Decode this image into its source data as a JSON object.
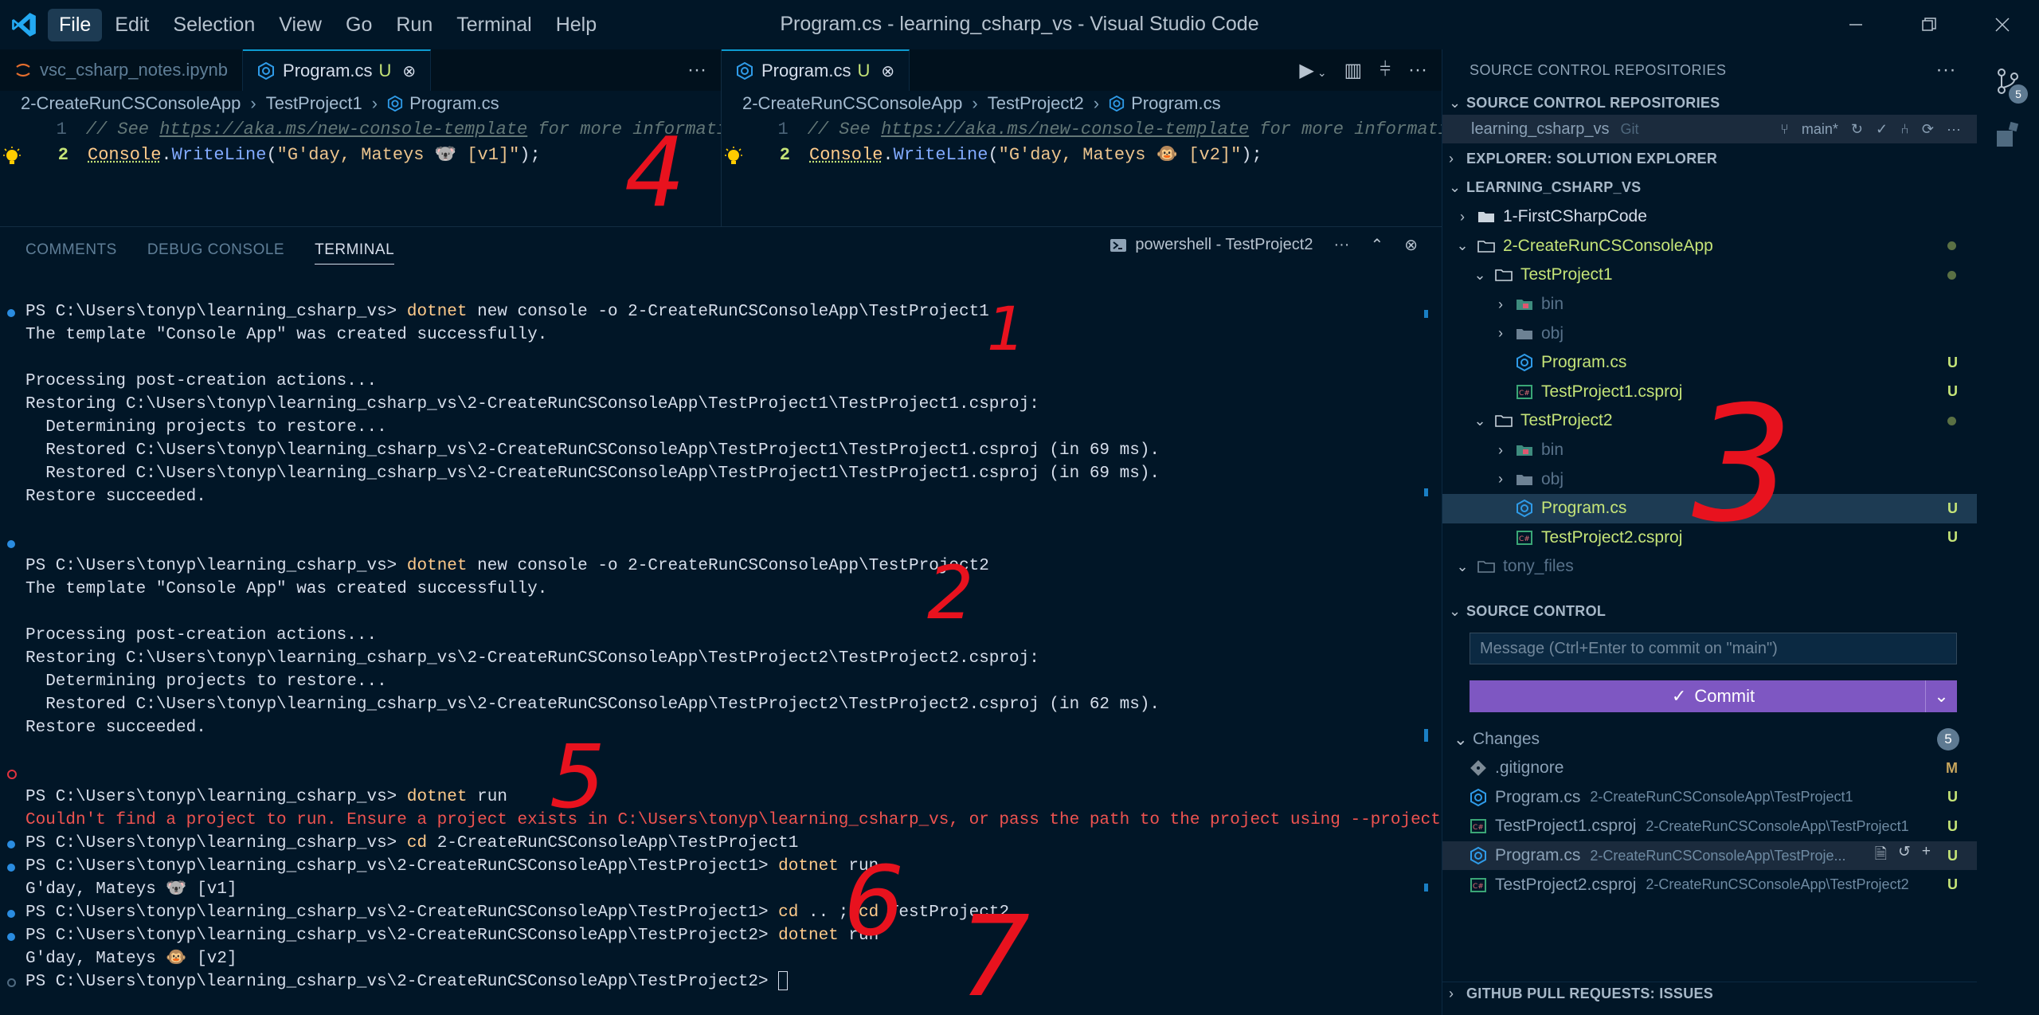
{
  "titlebar": {
    "menu": [
      "File",
      "Edit",
      "Selection",
      "View",
      "Go",
      "Run",
      "Terminal",
      "Help"
    ],
    "title": "Program.cs - learning_csharp_vs - Visual Studio Code"
  },
  "editor_left": {
    "tabs": [
      {
        "label": "vsc_csharp_notes.ipynb",
        "modified": ""
      },
      {
        "label": "Program.cs",
        "modified": "U"
      }
    ],
    "breadcrumb": [
      "2-CreateRunCSConsoleApp",
      "TestProject1",
      "Program.cs"
    ],
    "lines": [
      {
        "num": "1",
        "comment_prefix": "// See ",
        "url": "https://aka.ms/new-console-template",
        "comment_suffix": " for more informatio"
      },
      {
        "num": "2",
        "class": "Console",
        "dot": ".",
        "method": "WriteLine",
        "open": "(",
        "string": "\"G'day, Mateys 🐨 [v1]\"",
        "close": ");"
      }
    ]
  },
  "editor_right": {
    "tabs": [
      {
        "label": "Program.cs",
        "modified": "U"
      }
    ],
    "breadcrumb": [
      "2-CreateRunCSConsoleApp",
      "TestProject2",
      "Program.cs"
    ],
    "lines": [
      {
        "num": "1",
        "comment_prefix": "// See ",
        "url": "https://aka.ms/new-console-template",
        "comment_suffix": " for more informatio"
      },
      {
        "num": "2",
        "class": "Console",
        "dot": ".",
        "method": "WriteLine",
        "open": "(",
        "string": "\"G'day, Mateys 🐵 [v2]\"",
        "close": ");"
      }
    ]
  },
  "panel": {
    "tabs": [
      "COMMENTS",
      "DEBUG CONSOLE",
      "TERMINAL"
    ],
    "terminal_name": "powershell - TestProject2"
  },
  "terminal": {
    "prompt_root": "PS C:\\Users\\tonyp\\learning_csharp_vs> ",
    "prompt_tp1": "PS C:\\Users\\tonyp\\learning_csharp_vs\\2-CreateRunCSConsoleApp\\TestProject1> ",
    "prompt_tp2": "PS C:\\Users\\tonyp\\learning_csharp_vs\\2-CreateRunCSConsoleApp\\TestProject2> ",
    "dotnet": "dotnet",
    "cmd1_rest": " new console -o 2-CreateRunCSConsoleApp\\TestProject1",
    "cmd2_rest": " new console -o 2-CreateRunCSConsoleApp\\TestProject2",
    "cmd_run_rest": " run",
    "cmd_cd1": "cd",
    "cmd_cd1_rest": " 2-CreateRunCSConsoleApp\\TestProject1",
    "cmd_cd2_a": "cd",
    "cmd_cd2_b": " .. ; ",
    "cmd_cd2_c": "cd",
    "cmd_cd2_d": " TestProject2",
    "created": "The template \"Console App\" was created successfully.",
    "post": "Processing post-creation actions...",
    "restoring1": "Restoring C:\\Users\\tonyp\\learning_csharp_vs\\2-CreateRunCSConsoleApp\\TestProject1\\TestProject1.csproj:",
    "determining": "  Determining projects to restore...",
    "restored1": "  Restored C:\\Users\\tonyp\\learning_csharp_vs\\2-CreateRunCSConsoleApp\\TestProject1\\TestProject1.csproj (in 69 ms).",
    "succeeded": "Restore succeeded.",
    "restoring2": "Restoring C:\\Users\\tonyp\\learning_csharp_vs\\2-CreateRunCSConsoleApp\\TestProject2\\TestProject2.csproj:",
    "restored2": "  Restored C:\\Users\\tonyp\\learning_csharp_vs\\2-CreateRunCSConsoleApp\\TestProject2\\TestProject2.csproj (in 62 ms).",
    "error": "Couldn't find a project to run. Ensure a project exists in C:\\Users\\tonyp\\learning_csharp_vs, or pass the path to the project using --project.",
    "out_v1": "G'day, Mateys 🐨 [v1]",
    "out_v2": "G'day, Mateys 🐵 [v2]"
  },
  "sidebar": {
    "title": "SOURCE CONTROL REPOSITORIES",
    "sections": {
      "repos": "SOURCE CONTROL REPOSITORIES",
      "solution": "EXPLORER: SOLUTION EXPLORER",
      "folder": "LEARNING_CSHARP_VS",
      "source_control": "SOURCE CONTROL",
      "github": "GITHUB PULL REQUESTS: ISSUES"
    },
    "repo": {
      "name": "learning_csharp_vs",
      "provider": "Git",
      "branch": "main*"
    },
    "tree": [
      {
        "label": "1-FirstCSharpCode",
        "badge": ""
      },
      {
        "label": "2-CreateRunCSConsoleApp",
        "badge": ""
      },
      {
        "label": "TestProject1",
        "badge": ""
      },
      {
        "label": "bin",
        "badge": ""
      },
      {
        "label": "obj",
        "badge": ""
      },
      {
        "label": "Program.cs",
        "badge": "U"
      },
      {
        "label": "TestProject1.csproj",
        "badge": "U"
      },
      {
        "label": "TestProject2",
        "badge": ""
      },
      {
        "label": "bin",
        "badge": ""
      },
      {
        "label": "obj",
        "badge": ""
      },
      {
        "label": "Program.cs",
        "badge": "U"
      },
      {
        "label": "TestProject2.csproj",
        "badge": "U"
      },
      {
        "label": "tony_files",
        "badge": ""
      }
    ],
    "message_placeholder": "Message (Ctrl+Enter to commit on \"main\")",
    "commit_label": "Commit",
    "changes_label": "Changes",
    "changes_count": "5",
    "changes": [
      {
        "label": ".gitignore",
        "path": "",
        "badge": "M"
      },
      {
        "label": "Program.cs",
        "path": "2-CreateRunCSConsoleApp\\TestProject1",
        "badge": "U"
      },
      {
        "label": "TestProject1.csproj",
        "path": "2-CreateRunCSConsoleApp\\TestProject1",
        "badge": "U"
      },
      {
        "label": "Program.cs",
        "path": "2-CreateRunCSConsoleApp\\TestProje...",
        "badge": "U"
      },
      {
        "label": "TestProject2.csproj",
        "path": "2-CreateRunCSConsoleApp\\TestProject2",
        "badge": "U"
      }
    ]
  },
  "activity": {
    "scm_badge": "5"
  },
  "annotations": [
    "1",
    "2",
    "3",
    "4",
    "5",
    "6",
    "7"
  ],
  "colors": {
    "background": "#011627",
    "accent_purple": "#7e57c2",
    "untracked_green": "#c5e478",
    "error_red": "#ef5350",
    "annotation_red": "#e8121e",
    "focus_blue": "#0d9bd1"
  }
}
